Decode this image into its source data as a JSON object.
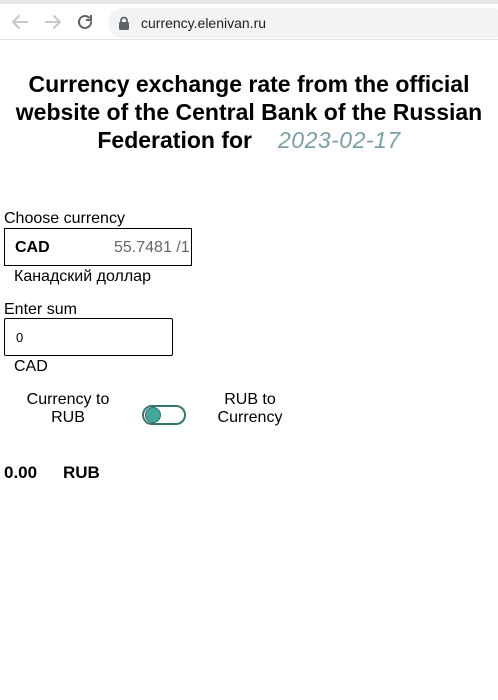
{
  "browser": {
    "url": "currency.elenivan.ru",
    "back_icon": "arrow-left-icon",
    "forward_icon": "arrow-right-icon",
    "reload_icon": "reload-icon",
    "lock_icon": "lock-icon"
  },
  "header": {
    "title": "Currency exchange rate from the official website of the Central Bank of the Russian Federation for",
    "date": "2023-02-17"
  },
  "currency_select": {
    "label": "Choose currency",
    "selected_code": "CAD",
    "selected_rate": "55.7481 /1",
    "currency_name": "Канадский доллар"
  },
  "sum": {
    "label": "Enter sum",
    "value": "0",
    "currency_code": "CAD"
  },
  "direction_toggle": {
    "left_label": "Currency to RUB",
    "right_label": "RUB to Currency",
    "state": "Currency to RUB"
  },
  "result": {
    "amount": "0.00",
    "currency": "RUB"
  },
  "colors": {
    "accent": "#43a79b",
    "accent_border": "#36766f",
    "date": "#7b9fa6"
  }
}
